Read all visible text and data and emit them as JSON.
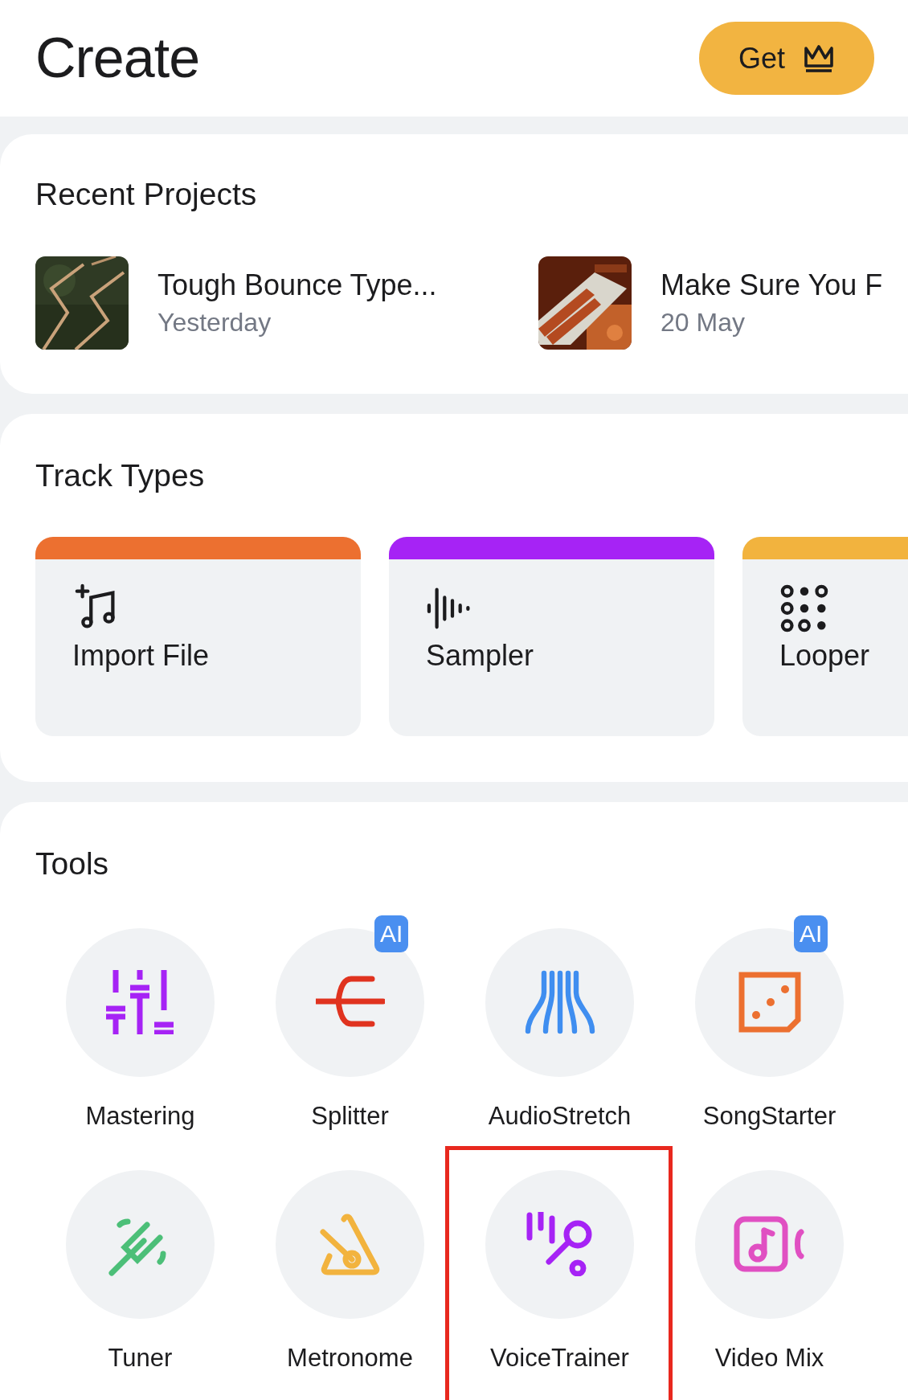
{
  "header": {
    "title": "Create",
    "get_button": {
      "label": "Get"
    }
  },
  "recent_projects": {
    "title": "Recent Projects",
    "items": [
      {
        "title": "Tough Bounce Type...",
        "date": "Yesterday"
      },
      {
        "title": "Make Sure You F",
        "date": "20 May"
      }
    ]
  },
  "track_types": {
    "title": "Track Types",
    "items": [
      {
        "label": "Import File",
        "color": "#ec7030"
      },
      {
        "label": "Sampler",
        "color": "#a623f5"
      },
      {
        "label": "Looper",
        "color": "#f2b33e"
      }
    ]
  },
  "tools": {
    "title": "Tools",
    "items": [
      {
        "label": "Mastering",
        "highlighted": false
      },
      {
        "label": "Splitter",
        "badge": "AI",
        "highlighted": false
      },
      {
        "label": "AudioStretch",
        "highlighted": false
      },
      {
        "label": "SongStarter",
        "badge": "AI",
        "highlighted": false
      },
      {
        "label": "Tuner",
        "highlighted": false
      },
      {
        "label": "Metronome",
        "highlighted": false
      },
      {
        "label": "VoiceTrainer",
        "highlighted": true
      },
      {
        "label": "Video Mix",
        "highlighted": false
      }
    ]
  }
}
